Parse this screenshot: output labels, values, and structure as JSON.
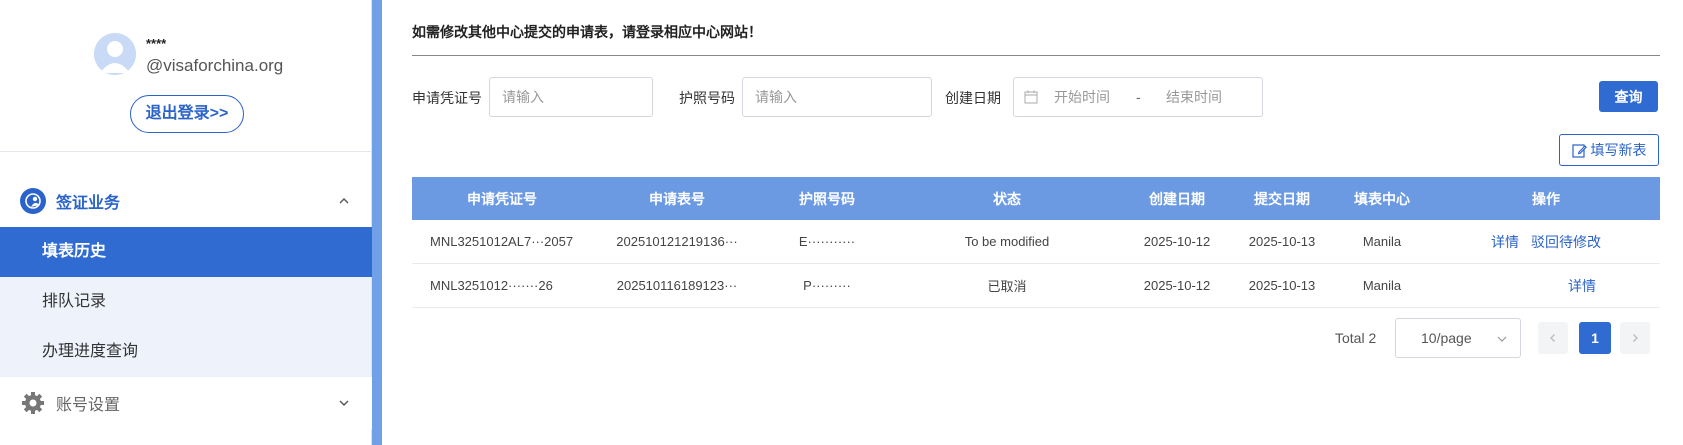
{
  "user": {
    "name": "****",
    "email": "@visaforchina.org",
    "logout_label": "退出登录>>"
  },
  "menu": {
    "visa_group": {
      "label": "签证业务",
      "icon": "globe-person-icon"
    },
    "items": [
      {
        "label": "填表历史",
        "active": true
      },
      {
        "label": "排队记录",
        "active": false
      },
      {
        "label": "办理进度查询",
        "active": false
      }
    ],
    "account_group": {
      "label": "账号设置",
      "icon": "gear-icon"
    }
  },
  "notice": "如需修改其他中心提交的申请表，请登录相应中心网站！",
  "filters": {
    "app_no_label": "申请凭证号",
    "app_no_placeholder": "请输入",
    "passport_label": "护照号码",
    "passport_placeholder": "请输入",
    "date_label": "创建日期",
    "start_placeholder": "开始时间",
    "date_sep": "-",
    "end_placeholder": "结束时间",
    "query_label": "查询"
  },
  "new_form_label": "填写新表",
  "table": {
    "headers": [
      "申请凭证号",
      "申请表号",
      "护照号码",
      "状态",
      "创建日期",
      "提交日期",
      "填表中心",
      "操作"
    ],
    "rows": [
      {
        "app_no": "MNL3251012AL7···2057",
        "form_no": "202510121219136···",
        "passport": "E···········",
        "status": "To be modified",
        "created": "2025-10-12",
        "submitted": "2025-10-13",
        "center": "Manila",
        "actions": [
          "详情",
          "驳回待修改"
        ]
      },
      {
        "app_no": "MNL3251012·······26",
        "form_no": "202510116189123···",
        "passport": "P·········",
        "status": "已取消",
        "created": "2025-10-12",
        "submitted": "2025-10-13",
        "center": "Manila",
        "actions": [
          "详情"
        ]
      }
    ]
  },
  "pagination": {
    "total_label": "Total 2",
    "page_size": "10/page",
    "current_page": "1"
  },
  "colors": {
    "primary": "#2f6bd1",
    "table_header": "#6b9ae2",
    "link": "#2a63c9"
  }
}
